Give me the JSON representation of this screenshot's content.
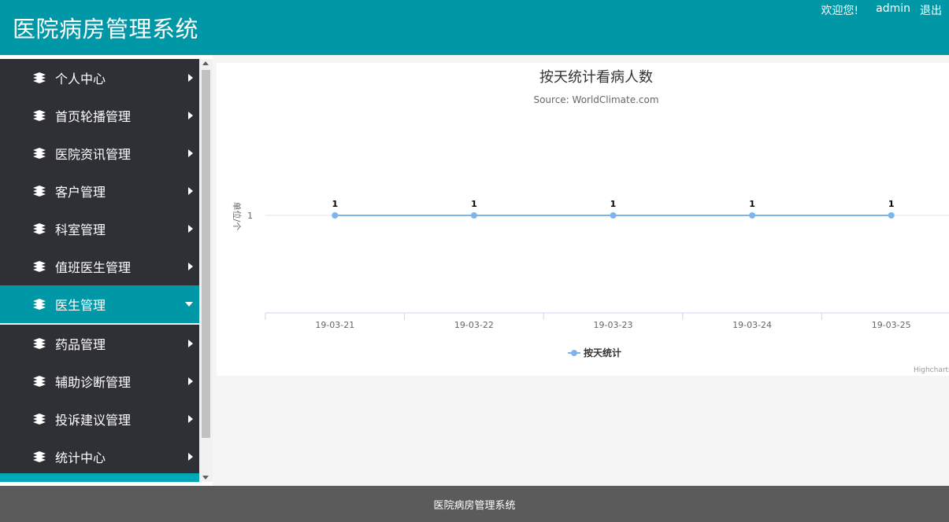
{
  "header": {
    "title": "医院病房管理系统",
    "welcome": "欢迎您!",
    "user": "admin",
    "logout": "退出"
  },
  "sidebar": {
    "items": [
      {
        "label": "个人中心",
        "expanded": false
      },
      {
        "label": "首页轮播管理",
        "expanded": false
      },
      {
        "label": "医院资讯管理",
        "expanded": false
      },
      {
        "label": "客户管理",
        "expanded": false
      },
      {
        "label": "科室管理",
        "expanded": false
      },
      {
        "label": "值班医生管理",
        "expanded": false
      },
      {
        "label": "医生管理",
        "expanded": true
      },
      {
        "label": "药品管理",
        "expanded": false
      },
      {
        "label": "辅助诊断管理",
        "expanded": false
      },
      {
        "label": "投诉建议管理",
        "expanded": false
      },
      {
        "label": "统计中心",
        "expanded": false
      }
    ]
  },
  "colors": {
    "accent": "#0097a7",
    "sidebar_bg": "#2f3036",
    "series": "#7cb5ec",
    "footer_bg": "#5b5b5b"
  },
  "chart_data": {
    "type": "line",
    "title": "按天统计看病人数",
    "subtitle": "Source: WorldClimate.com",
    "ylabel": "单位/个",
    "xlabel": "",
    "categories": [
      "19-03-21",
      "19-03-22",
      "19-03-23",
      "19-03-24",
      "19-03-25"
    ],
    "y_ticks": [
      1
    ],
    "series": [
      {
        "name": "按天统计",
        "values": [
          1,
          1,
          1,
          1,
          1
        ]
      }
    ],
    "data_labels": true,
    "legend": "bottom-center",
    "credits": "Highcharts.com"
  },
  "footer": {
    "text": "医院病房管理系统"
  }
}
